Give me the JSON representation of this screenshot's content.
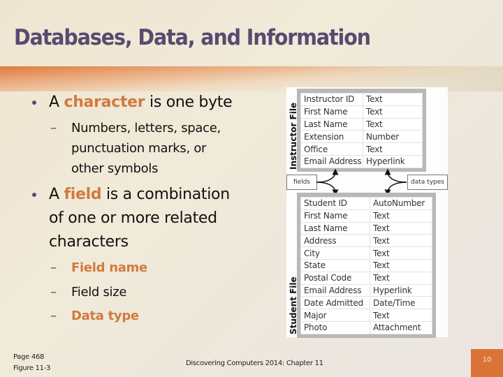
{
  "slide": {
    "title": "Databases, Data, and Information",
    "accent_color": "#d27a3e",
    "title_color": "#584a70"
  },
  "bullets": {
    "b1": {
      "prefix": "A ",
      "highlight": "character",
      "suffix": " is one byte",
      "sub": [
        "Numbers, letters, space,",
        "punctuation marks, or",
        "other symbols"
      ]
    },
    "b2": {
      "prefix": "A ",
      "highlight": "field",
      "suffix": " is a combination",
      "line2": "of one or more related",
      "line3": "characters",
      "sub": [
        {
          "text": "Field name",
          "highlighted": true
        },
        {
          "text": "Field size",
          "highlighted": false
        },
        {
          "text": "Data type",
          "highlighted": true
        }
      ]
    }
  },
  "figure": {
    "instructor_label": "Instructor File",
    "student_label": "Student File",
    "callout_fields": "fields",
    "callout_data_types": "data types",
    "instructor_rows": [
      [
        "Instructor ID",
        "Text"
      ],
      [
        "First Name",
        "Text"
      ],
      [
        "Last Name",
        "Text"
      ],
      [
        "Extension",
        "Number"
      ],
      [
        "Office",
        "Text"
      ],
      [
        "Email Address",
        "Hyperlink"
      ]
    ],
    "student_rows": [
      [
        "Student ID",
        "AutoNumber"
      ],
      [
        "First Name",
        "Text"
      ],
      [
        "Last Name",
        "Text"
      ],
      [
        "Address",
        "Text"
      ],
      [
        "City",
        "Text"
      ],
      [
        "State",
        "Text"
      ],
      [
        "Postal Code",
        "Text"
      ],
      [
        "Email Address",
        "Hyperlink"
      ],
      [
        "Date Admitted",
        "Date/Time"
      ],
      [
        "Major",
        "Text"
      ],
      [
        "Photo",
        "Attachment"
      ]
    ]
  },
  "footer": {
    "page_ref": "Page 468",
    "figure_ref": "Figure 11-3",
    "course": "Discovering Computers 2014: Chapter 11",
    "slide_number": "10"
  }
}
